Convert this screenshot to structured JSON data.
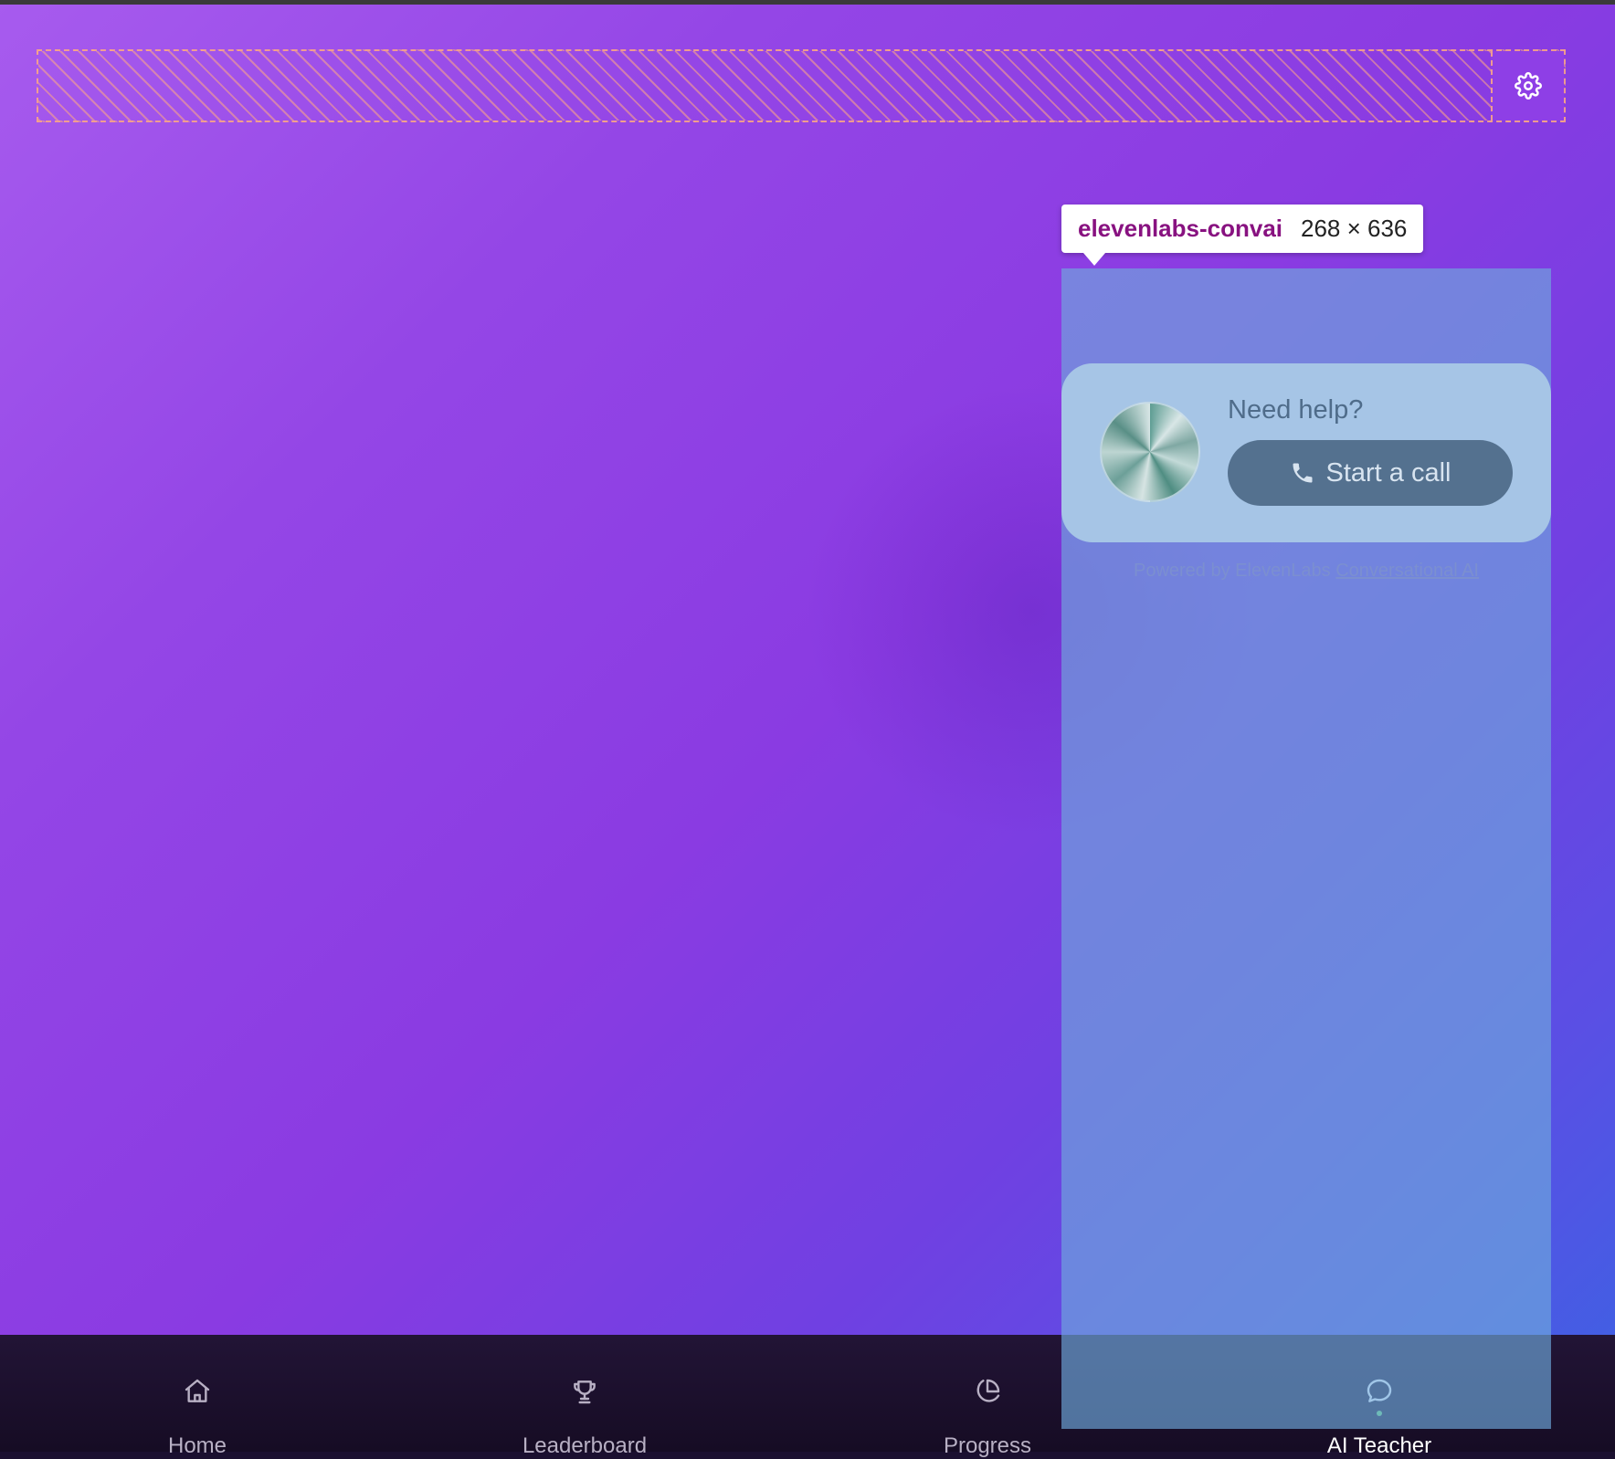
{
  "header": {
    "settings_icon": "gear-icon"
  },
  "inspector": {
    "tag": "elevenlabs-convai",
    "size": "268 × 636"
  },
  "widget": {
    "title": "Need help?",
    "call_button": "Start a call",
    "call_icon": "phone-icon",
    "powered_prefix": "Powered by ElevenLabs ",
    "powered_link": "Conversational AI"
  },
  "nav": {
    "items": [
      {
        "label": "Home",
        "icon": "home-icon",
        "active": false
      },
      {
        "label": "Leaderboard",
        "icon": "trophy-icon",
        "active": false
      },
      {
        "label": "Progress",
        "icon": "pie-chart-icon",
        "active": false
      },
      {
        "label": "AI Teacher",
        "icon": "chat-bubble-icon",
        "active": true
      }
    ]
  },
  "colors": {
    "background_start": "#a75bee",
    "background_mid": "#8a3be2",
    "background_end": "#3b63e3",
    "nav_background": "#1b1030",
    "active_dot": "#6ddc74",
    "call_button": "#54718f"
  }
}
